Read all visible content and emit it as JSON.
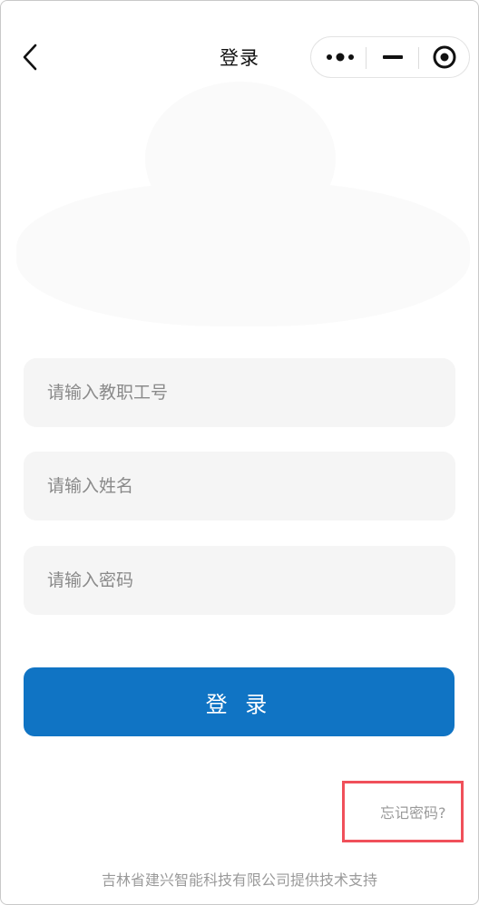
{
  "nav": {
    "title": "登录"
  },
  "form": {
    "employee_id_placeholder": "请输入教职工号",
    "name_placeholder": "请输入姓名",
    "password_placeholder": "请输入密码"
  },
  "login_button": "登 录",
  "forgot_password": "忘记密码?",
  "footer": "吉林省建兴智能科技有限公司提供技术支持",
  "colors": {
    "primary": "#1074c4",
    "highlight_box": "#f0505a",
    "input_bg": "#f5f5f5"
  }
}
